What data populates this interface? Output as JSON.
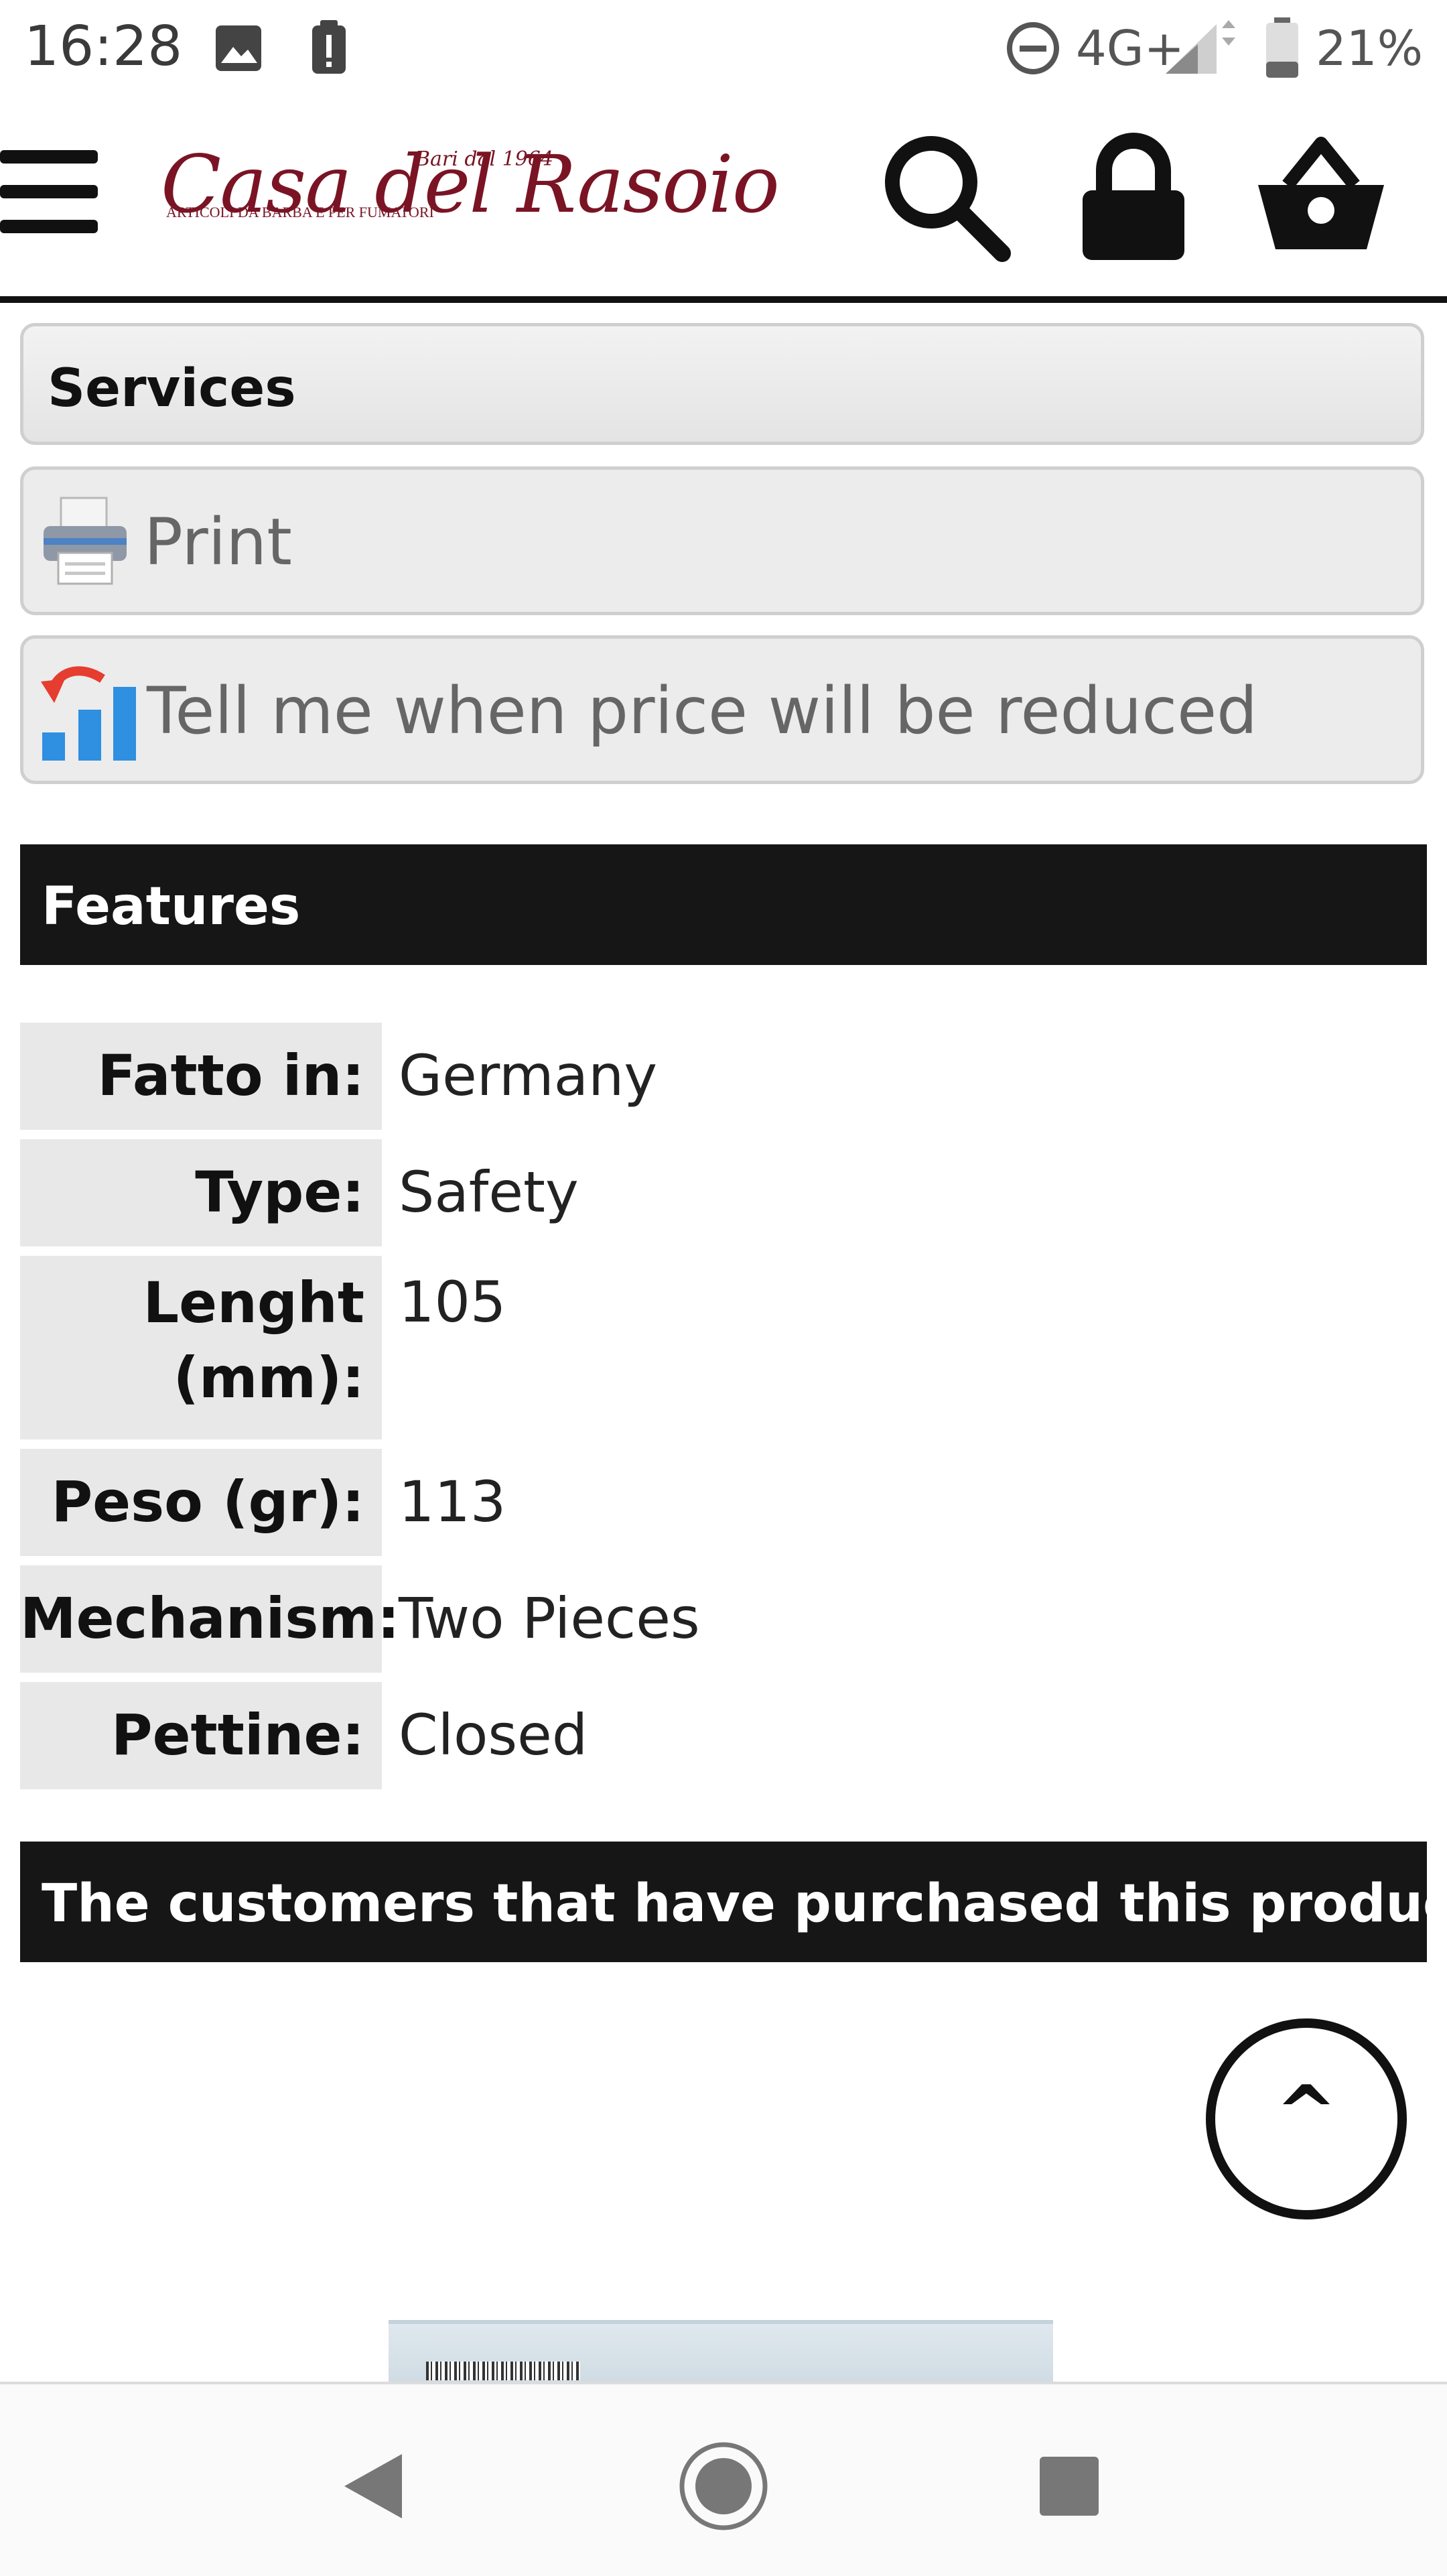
{
  "status_bar": {
    "time": "16:28",
    "network": "4G+",
    "battery": "21%",
    "icons": [
      "image-notification-icon",
      "alert-notification-icon",
      "do-not-disturb-icon",
      "signal-icon",
      "battery-icon"
    ]
  },
  "header": {
    "logo_title": "Casa del Rasoio",
    "logo_since": "Bari dal 1964",
    "logo_subtitle": "ARTICOLI DA BARBA E PER FUMATORI",
    "icons": [
      "menu-icon",
      "search-icon",
      "lock-icon",
      "basket-icon"
    ]
  },
  "services": {
    "title": "Services",
    "print_label": "Print",
    "price_alert_label": "Tell me when price will be reduced"
  },
  "features": {
    "title": "Features",
    "rows": [
      {
        "key": "Fatto in:",
        "value": "Germany"
      },
      {
        "key": "Type:",
        "value": "Safety"
      },
      {
        "key_line1": "Lenght",
        "key_line2": "(mm):",
        "value": "105"
      },
      {
        "key": "Peso (gr):",
        "value": "113"
      },
      {
        "key": "Mechanism:",
        "value": "Two Pieces"
      },
      {
        "key": "Pettine:",
        "value": "Closed"
      }
    ]
  },
  "related": {
    "title": "The customers that have purchased this product, have also purchased"
  },
  "scroll_top": {
    "label": "^"
  },
  "colors": {
    "accent_dark": "#161616",
    "logo": "#7a1424",
    "feature_key_bg": "#e8e8e8"
  }
}
